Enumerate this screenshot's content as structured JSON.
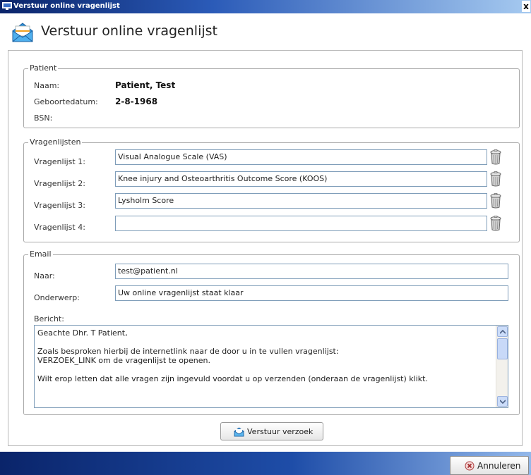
{
  "window": {
    "title": "Verstuur online vragenlijst",
    "close_glyph": "x"
  },
  "header": {
    "title": "Verstuur online vragenlijst",
    "icon": "envelope-icon"
  },
  "patient": {
    "legend": "Patient",
    "name_label": "Naam:",
    "name_value": "Patient, Test",
    "dob_label": "Geboortedatum:",
    "dob_value": "2-8-1968",
    "bsn_label": "BSN:",
    "bsn_value": ""
  },
  "questionnaires": {
    "legend": "Vragenlijsten",
    "items": [
      {
        "label": "Vragenlijst 1:",
        "value": "Visual Analogue Scale (VAS)"
      },
      {
        "label": "Vragenlijst 2:",
        "value": "Knee injury and Osteoarthritis Outcome Score (KOOS)"
      },
      {
        "label": "Vragenlijst 3:",
        "value": "Lysholm Score"
      },
      {
        "label": "Vragenlijst 4:",
        "value": ""
      }
    ],
    "delete_icon": "trash-icon"
  },
  "email": {
    "legend": "Email",
    "to_label": "Naar:",
    "to_value": "test@patient.nl",
    "subject_label": "Onderwerp:",
    "subject_value": "Uw online vragenlijst staat klaar",
    "message_label": "Bericht:",
    "message_lines": [
      "Geachte Dhr. T Patient,",
      "",
      "Zoals besproken hierbij de internetlink naar de door u in te vullen vragenlijst:",
      "VERZOEK_LINK om de vragenlijst te openen.",
      "",
      "Wilt erop letten dat alle vragen zijn ingevuld voordat u op verzenden (onderaan de vragenlijst) klikt."
    ]
  },
  "actions": {
    "send_label": "Verstuur verzoek",
    "cancel_label": "Annuleren"
  },
  "colors": {
    "titlebar": "#0a246a",
    "accent": "#2b5bb8",
    "field_border": "#7f9db9"
  }
}
